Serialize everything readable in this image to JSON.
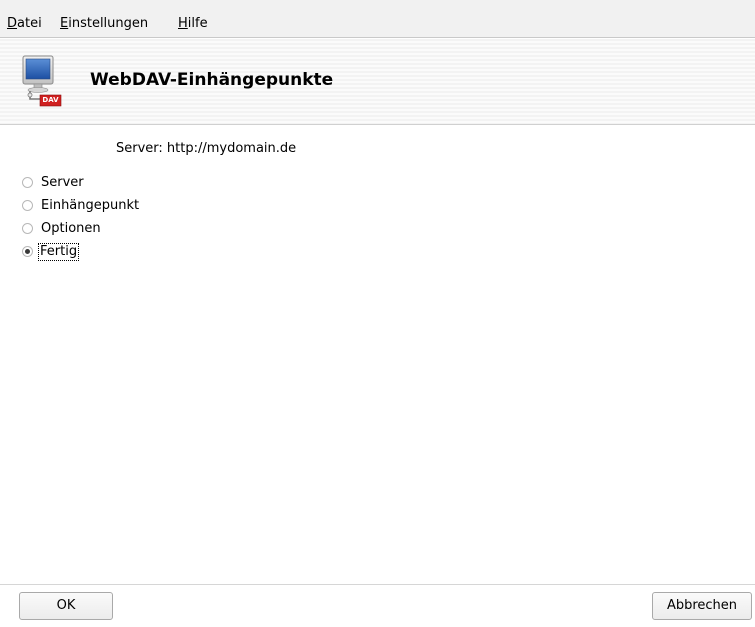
{
  "menubar": {
    "items": [
      {
        "access": "D",
        "rest": "atei"
      },
      {
        "access": "E",
        "rest": "instellungen"
      },
      {
        "access": "H",
        "rest": "ilfe"
      }
    ]
  },
  "header": {
    "title": "WebDAV-Einhängepunkte",
    "icon": "webdav-monitor-icon",
    "icon_badge": "DAV",
    "badge_color": "#d02020"
  },
  "main": {
    "server_line": "Server: http://mydomain.de",
    "steps": [
      {
        "label": "Server",
        "checked": false
      },
      {
        "label": "Einhängepunkt",
        "checked": false
      },
      {
        "label": "Optionen",
        "checked": false
      },
      {
        "label": "Fertig",
        "checked": true
      }
    ]
  },
  "footer": {
    "ok_label": "OK",
    "cancel_label": "Abbrechen"
  }
}
